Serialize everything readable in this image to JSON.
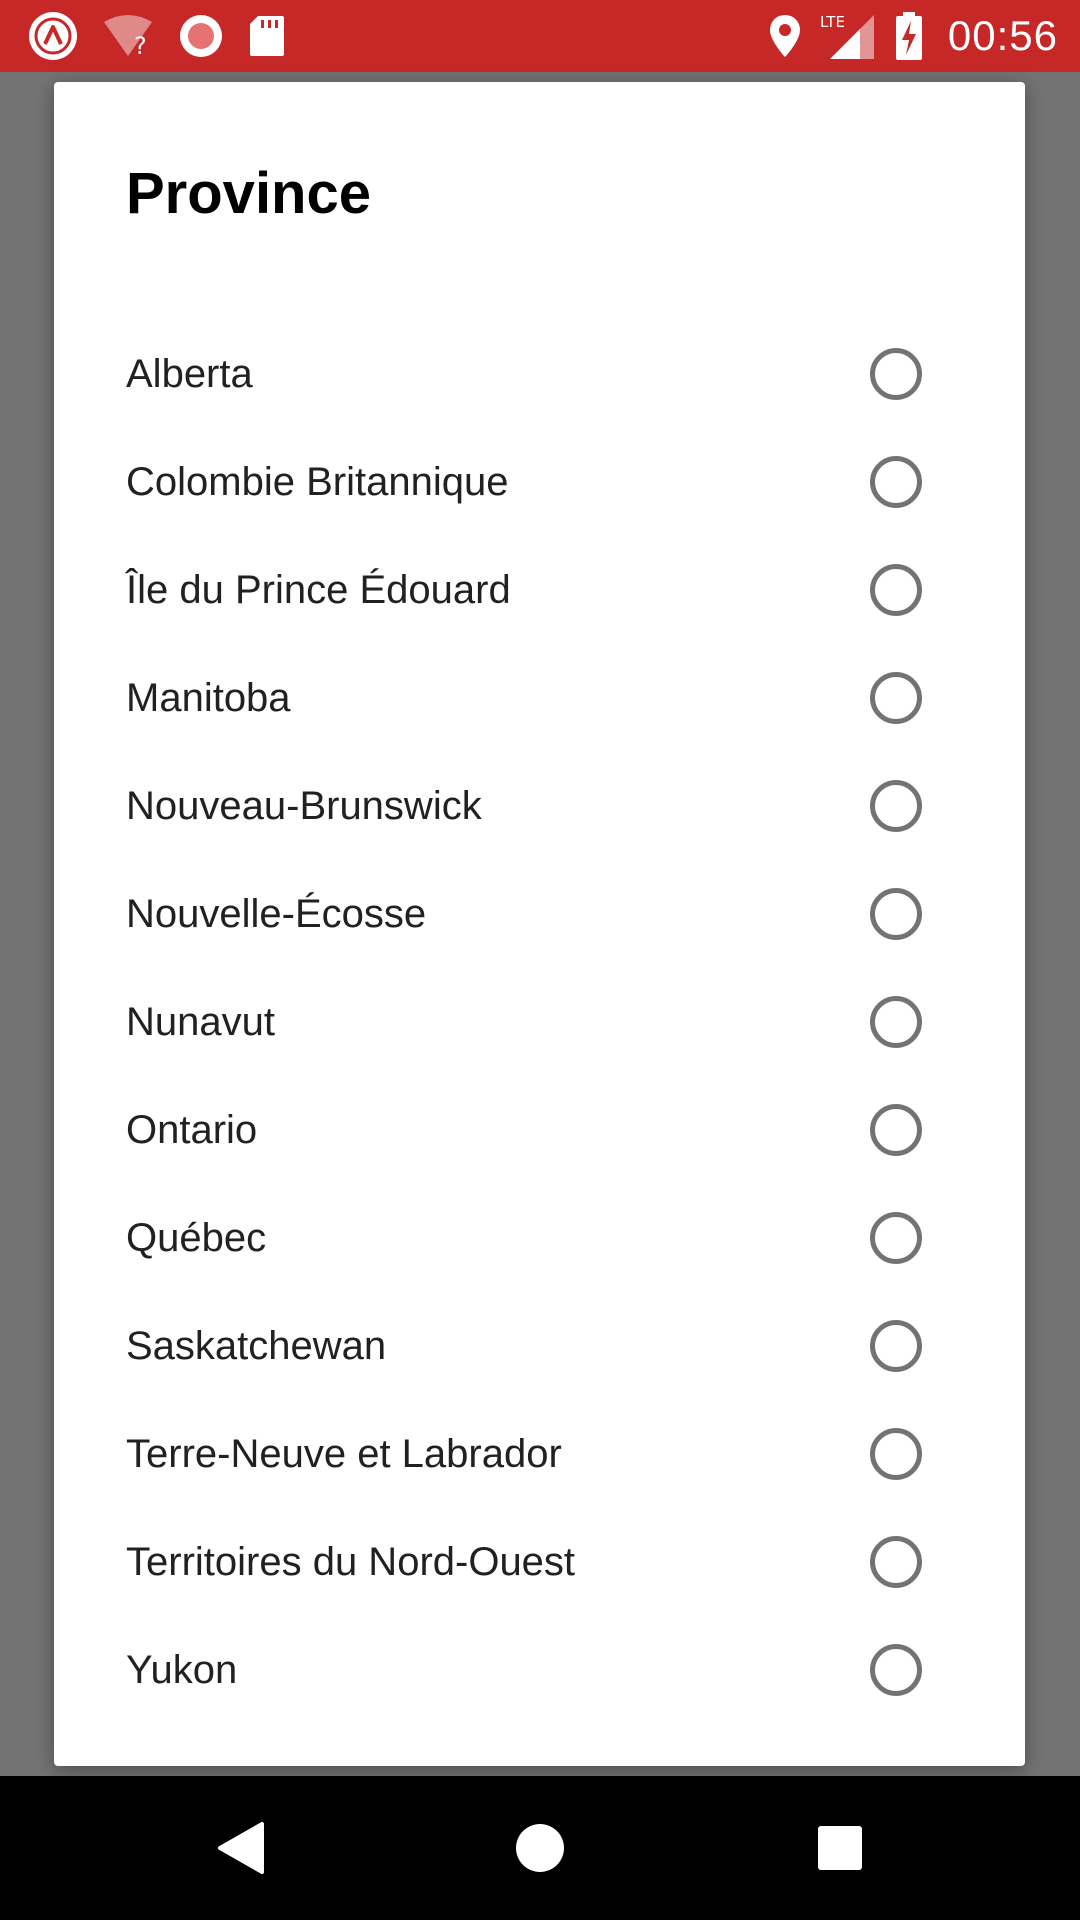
{
  "status_bar": {
    "time": "00:56",
    "network": "LTE",
    "background_color": "#c62828",
    "left_icons": [
      "app-notification-icon",
      "wifi-question-icon",
      "record-icon",
      "sd-card-icon"
    ],
    "right_icons": [
      "location-icon",
      "lte-signal-icon",
      "battery-charging-icon"
    ]
  },
  "dialog": {
    "title": "Province",
    "options": [
      {
        "label": "Alberta",
        "selected": false
      },
      {
        "label": "Colombie Britannique",
        "selected": false
      },
      {
        "label": "Île du Prince Édouard",
        "selected": false
      },
      {
        "label": "Manitoba",
        "selected": false
      },
      {
        "label": "Nouveau-Brunswick",
        "selected": false
      },
      {
        "label": "Nouvelle-Écosse",
        "selected": false
      },
      {
        "label": "Nunavut",
        "selected": false
      },
      {
        "label": "Ontario",
        "selected": false
      },
      {
        "label": "Québec",
        "selected": false
      },
      {
        "label": "Saskatchewan",
        "selected": false
      },
      {
        "label": "Terre-Neuve et Labrador",
        "selected": false
      },
      {
        "label": "Territoires du Nord-Ouest",
        "selected": false
      },
      {
        "label": "Yukon",
        "selected": false
      }
    ]
  },
  "nav_bar": {
    "buttons": [
      "back-icon",
      "home-icon",
      "recents-icon"
    ]
  }
}
